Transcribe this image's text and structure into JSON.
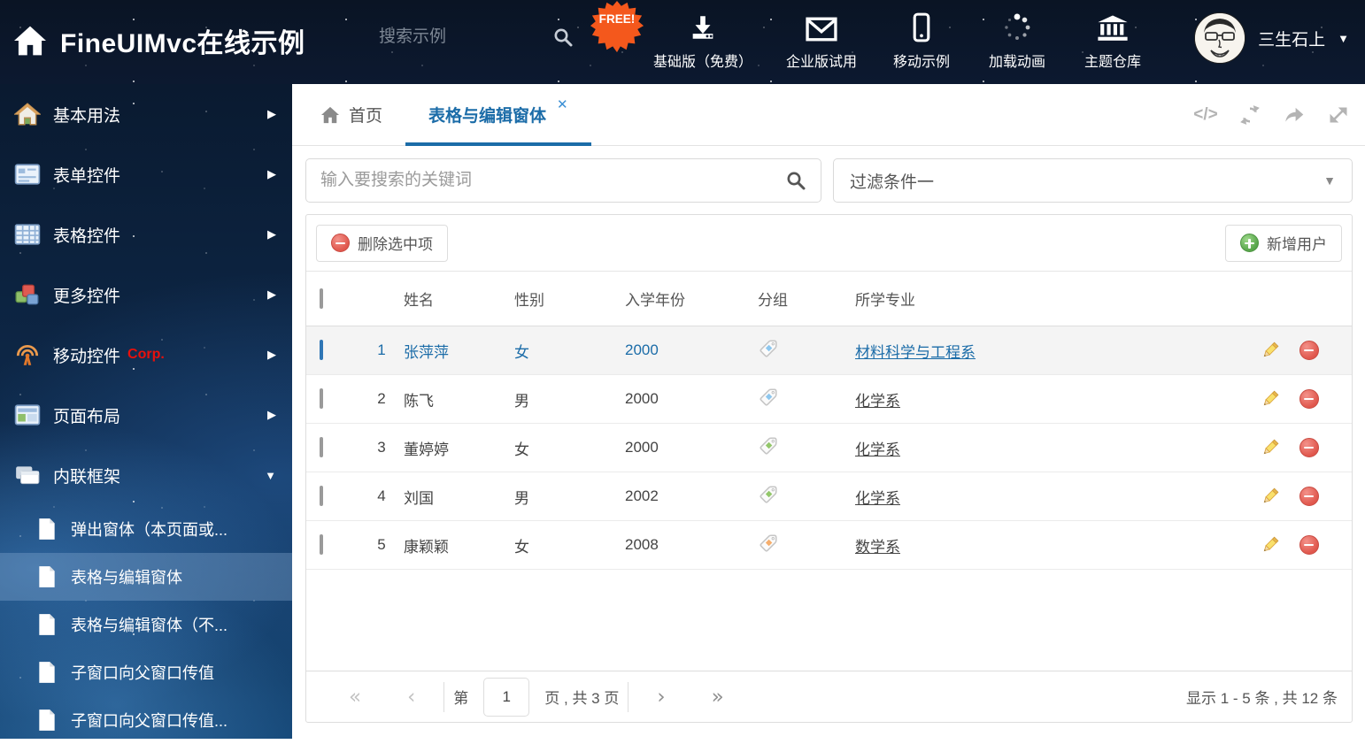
{
  "header": {
    "title": "FineUIMvc在线示例",
    "search_placeholder": "搜索示例",
    "free_badge": "FREE!",
    "nav_items": [
      {
        "label": "基础版（免费）",
        "icon": "download-icon"
      },
      {
        "label": "企业版试用",
        "icon": "envelope-icon"
      },
      {
        "label": "移动示例",
        "icon": "mobile-icon"
      },
      {
        "label": "加载动画",
        "icon": "spinner-icon"
      },
      {
        "label": "主题仓库",
        "icon": "bank-icon"
      }
    ],
    "username": "三生石上"
  },
  "sidebar": {
    "items": [
      {
        "label": "基本用法"
      },
      {
        "label": "表单控件"
      },
      {
        "label": "表格控件"
      },
      {
        "label": "更多控件"
      },
      {
        "label": "移动控件",
        "badge": "Corp."
      },
      {
        "label": "页面布局"
      },
      {
        "label": "内联框架"
      }
    ],
    "subitems": [
      {
        "label": "弹出窗体（本页面或..."
      },
      {
        "label": "表格与编辑窗体",
        "active": true
      },
      {
        "label": "表格与编辑窗体（不..."
      },
      {
        "label": "子窗口向父窗口传值"
      },
      {
        "label": "子窗口向父窗口传值..."
      }
    ]
  },
  "tabs": {
    "home_label": "首页",
    "active_label": "表格与编辑窗体"
  },
  "toolbar": {
    "search_placeholder": "输入要搜索的关键词",
    "filter_value": "过滤条件一",
    "delete_label": "删除选中项",
    "add_label": "新增用户"
  },
  "table": {
    "columns": [
      "姓名",
      "性别",
      "入学年份",
      "分组",
      "所学专业"
    ],
    "rows": [
      {
        "num": "1",
        "name": "张萍萍",
        "gender": "女",
        "year": "2000",
        "tag_color": "#8ec7ee",
        "major": "材料科学与工程系",
        "selected": true
      },
      {
        "num": "2",
        "name": "陈飞",
        "gender": "男",
        "year": "2000",
        "tag_color": "#8ec7ee",
        "major": "化学系",
        "selected": false
      },
      {
        "num": "3",
        "name": "董婷婷",
        "gender": "女",
        "year": "2000",
        "tag_color": "#93c76b",
        "major": "化学系",
        "selected": false
      },
      {
        "num": "4",
        "name": "刘国",
        "gender": "男",
        "year": "2002",
        "tag_color": "#93c76b",
        "major": "化学系",
        "selected": false
      },
      {
        "num": "5",
        "name": "康颖颖",
        "gender": "女",
        "year": "2008",
        "tag_color": "#f6ae6c",
        "major": "数学系",
        "selected": false
      }
    ]
  },
  "pagination": {
    "page_prefix": "第",
    "page_value": "1",
    "page_suffix": "页 , 共 3 页",
    "summary": "显示 1 - 5 条 , 共 12 条"
  },
  "colors": {
    "accent": "#1b6ca8",
    "danger": "#e0574d",
    "success": "#57a54a"
  }
}
